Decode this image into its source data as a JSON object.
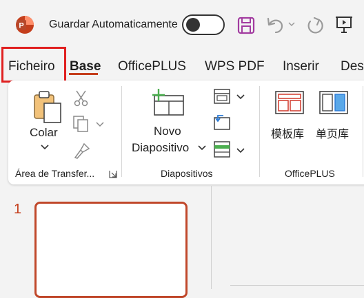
{
  "titlebar": {
    "autosave_label": "Guardar Automaticamente",
    "autosave_on": false
  },
  "tabs": [
    {
      "label": "Ficheiro"
    },
    {
      "label": "Base"
    },
    {
      "label": "OfficePLUS"
    },
    {
      "label": "WPS PDF"
    },
    {
      "label": "Inserir"
    },
    {
      "label": "Des"
    }
  ],
  "ribbon": {
    "clipboard": {
      "paste_label": "Colar",
      "group_label": "Área de Transfer..."
    },
    "slides": {
      "new_slide_line1": "Novo",
      "new_slide_line2": "Diapositivo",
      "group_label": "Diapositivos"
    },
    "officeplus": {
      "template_label": "模板库",
      "single_page_label": "单页库",
      "group_label": "OfficePLUS"
    }
  },
  "slides_pane": {
    "slide_number": "1"
  },
  "colors": {
    "accent": "#c43e1c",
    "focus_outline": "#e02020",
    "save_icon": "#a23ba0"
  }
}
